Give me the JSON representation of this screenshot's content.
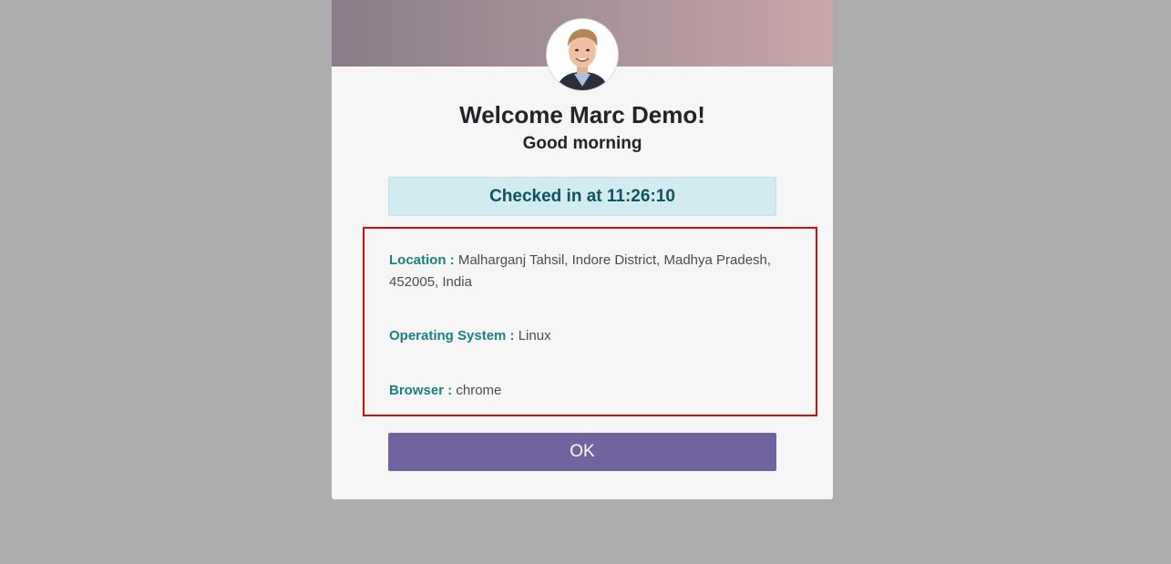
{
  "dialog": {
    "welcome_text": "Welcome Marc Demo!",
    "greeting": "Good morning",
    "checked_in_text": "Checked in at 11:26:10",
    "info": {
      "location_label": "Location :",
      "location_value": "Malharganj Tahsil, Indore District, Madhya Pradesh, 452005, India",
      "os_label": "Operating System :",
      "os_value": "Linux",
      "browser_label": "Browser :",
      "browser_value": "chrome"
    },
    "ok_label": "OK"
  },
  "colors": {
    "header_gradient_start": "#8a7d89",
    "header_gradient_end": "#c7a6a9",
    "checkin_background": "#d1ebf0",
    "checkin_text": "#0c5460",
    "label_color": "#1a7f80",
    "highlight_border": "#d10f0f",
    "button_background": "#71639e"
  },
  "icons": {
    "avatar": "user-avatar-photo"
  }
}
